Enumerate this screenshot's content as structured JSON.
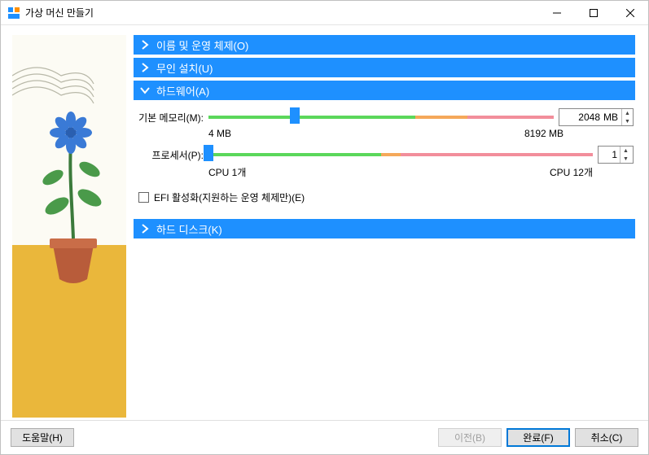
{
  "window": {
    "title": "가상 머신 만들기"
  },
  "sections": {
    "name_os": {
      "label": "이름 및 운영 체제(O)"
    },
    "unattended": {
      "label": "무인 설치(U)"
    },
    "hardware": {
      "label": "하드웨어(A)"
    },
    "harddisk": {
      "label": "하드 디스크(K)"
    }
  },
  "hardware": {
    "memory": {
      "label": "기본 메모리(M):",
      "value": "2048",
      "unit": "MB",
      "min_label": "4 MB",
      "max_label": "8192 MB",
      "slider_pos_pct": 25,
      "green_pct": 60,
      "orange_pct": 15,
      "pink_pct": 25
    },
    "cpu": {
      "label": "프로세서(P):",
      "value": "1",
      "min_label": "CPU 1개",
      "max_label": "CPU 12개",
      "slider_pos_pct": 0,
      "green_pct": 45,
      "orange_pct": 5,
      "pink_pct": 50
    },
    "efi": {
      "label": "EFI 활성화(지원하는 운영 체제만)(E)",
      "checked": false
    }
  },
  "footer": {
    "help": "도움말(H)",
    "back": "이전(B)",
    "finish": "완료(F)",
    "cancel": "취소(C)"
  }
}
